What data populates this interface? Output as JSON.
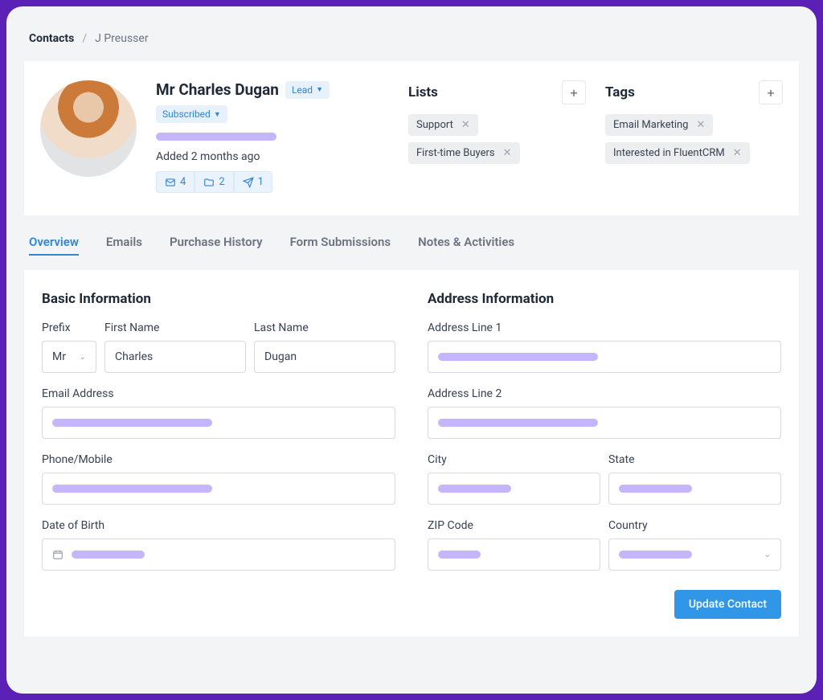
{
  "breadcrumb": {
    "root": "Contacts",
    "sep": "/",
    "current": "J Preusser"
  },
  "contact": {
    "name": "Mr Charles Dugan",
    "status1": "Lead",
    "status2": "Subscribed",
    "added": "Added 2 months ago",
    "stats": {
      "mail": "4",
      "folder": "2",
      "send": "1"
    }
  },
  "lists": {
    "title": "Lists",
    "items": [
      "Support",
      "First-time Buyers"
    ]
  },
  "tags": {
    "title": "Tags",
    "items": [
      "Email Marketing",
      "Interested in FluentCRM"
    ]
  },
  "tabs": [
    "Overview",
    "Emails",
    "Purchase History",
    "Form Submissions",
    "Notes & Activities"
  ],
  "activeTab": "Overview",
  "form": {
    "basic": {
      "title": "Basic Information",
      "prefix_label": "Prefix",
      "prefix_value": "Mr",
      "first_label": "First Name",
      "first_value": "Charles",
      "last_label": "Last Name",
      "last_value": "Dugan",
      "email_label": "Email Address",
      "phone_label": "Phone/Mobile",
      "dob_label": "Date of Birth"
    },
    "address": {
      "title": "Address Information",
      "line1_label": "Address Line 1",
      "line2_label": "Address Line 2",
      "city_label": "City",
      "state_label": "State",
      "zip_label": "ZIP Code",
      "country_label": "Country"
    },
    "submit": "Update Contact"
  }
}
